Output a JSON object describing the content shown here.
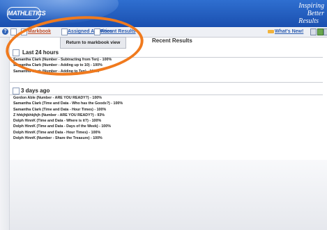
{
  "header": {
    "logo_text": "MATHLETICS",
    "tagline_line1": "Inspiring Better",
    "tagline_line2": "Results"
  },
  "toolbar": {
    "help_icon_glyph": "?",
    "tabs": [
      {
        "label": "Markbook"
      },
      {
        "label": "Assigned Activities"
      },
      {
        "label": "Recent Results"
      }
    ],
    "whats_new_label": "What's New!"
  },
  "tooltip": {
    "text": "Return to markbook view"
  },
  "page_title": "Recent Results",
  "sections": [
    {
      "title": "Last 24 hours",
      "items": [
        "Samantha Clark (Number - Subtracting from Ten) - 100%",
        "Samantha Clark (Number - Adding up to 10) - 100%",
        "Samantha Clark (Number - Adding to Ten) - 100%"
      ]
    },
    {
      "title": "3 days ago",
      "items": [
        "Gordon Able (Number - ARE YOU READY?) - 100%",
        "Samantha Clark (Time and Data - Who has the Goods?) - 100%",
        "Samantha Clark (Time and Data - Hour Times) - 100%",
        "Z hhkjhjkhkjhjh (Number - ARE YOU READY?) - 93%",
        "Dolph HinnK (Time and Data - Where is it?) - 100%",
        "Dolph HinnK (Time and Data - Days of the Week) - 100%",
        "Dolph HinnK (Time and Data - Hour Times) - 100%",
        "Dolph HinnK (Number - Share the Treasure) - 100%"
      ]
    }
  ],
  "colors": {
    "header_blue": "#1f57b8",
    "link_blue": "#2a5bb0",
    "active_tab": "#c0502b",
    "annotation_orange": "#f07a1e"
  }
}
